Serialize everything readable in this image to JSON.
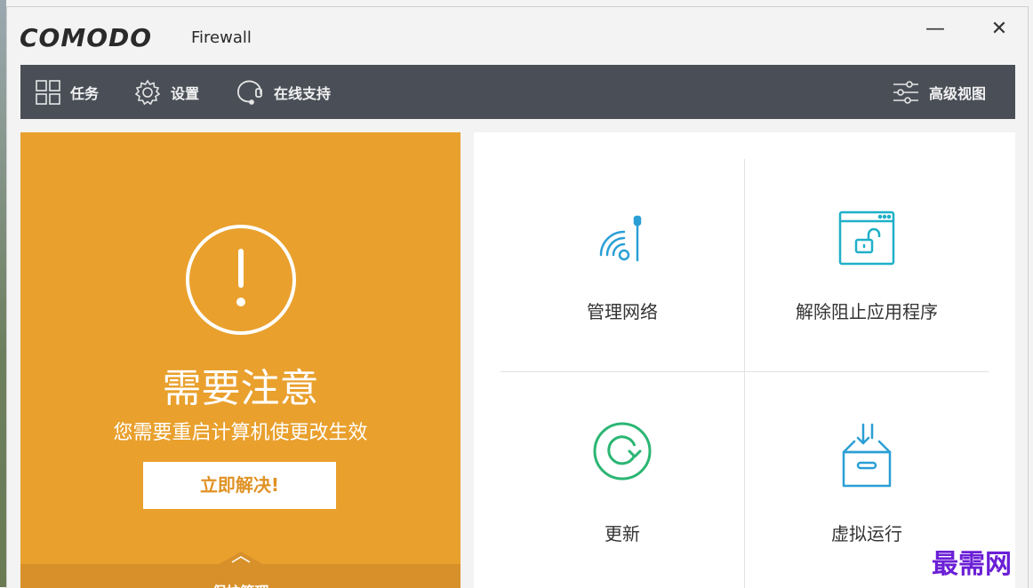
{
  "app": {
    "brand": "COMODO",
    "product": "Firewall"
  },
  "window_controls": {
    "minimize": "—",
    "close": "✕"
  },
  "toolbar": {
    "tasks": {
      "label": "任务",
      "icon": "grid-icon"
    },
    "settings": {
      "label": "设置",
      "icon": "gear-icon"
    },
    "support": {
      "label": "在线支持",
      "icon": "headset-icon"
    },
    "advanced_view": {
      "label": "高级视图",
      "icon": "sliders-icon"
    }
  },
  "status": {
    "title": "需要注意",
    "message": "您需要重启计算机使更改生效",
    "fix_button": "立即解决!",
    "bottom_label": "保护管理",
    "accent_color": "#e9a02d"
  },
  "tiles": [
    {
      "label": "管理网络",
      "icon": "wifi-network-icon",
      "color": "#2a9fd6"
    },
    {
      "label": "解除阻止应用程序",
      "icon": "unlock-window-icon",
      "color": "#1fb0c8"
    },
    {
      "label": "更新",
      "icon": "refresh-icon",
      "color": "#2bb673"
    },
    {
      "label": "虚拟运行",
      "icon": "sandbox-box-icon",
      "color": "#2a9fd6"
    }
  ],
  "watermark": "最需网"
}
